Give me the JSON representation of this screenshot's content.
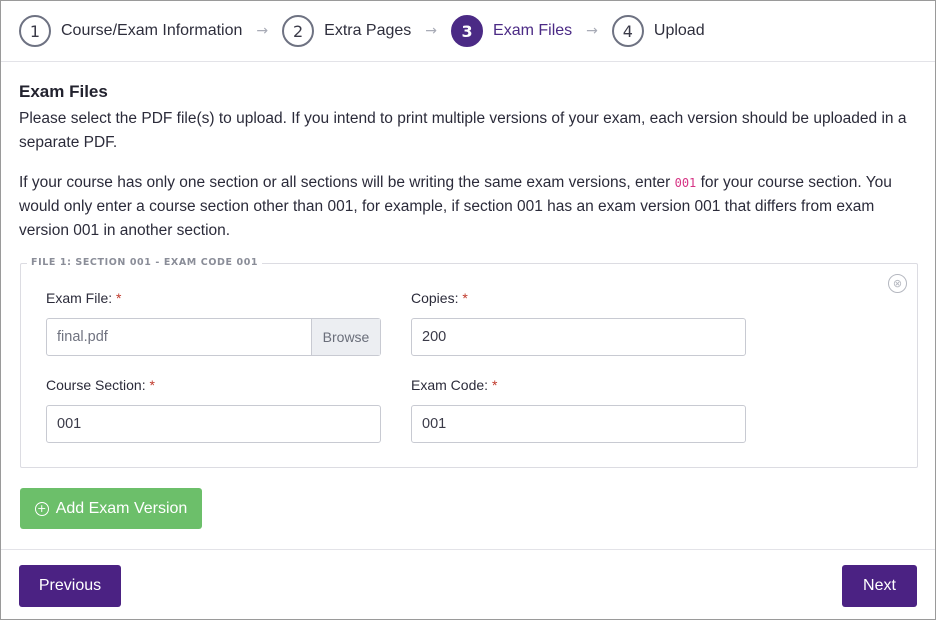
{
  "stepper": {
    "steps": [
      {
        "number": "1",
        "label": "Course/Exam Information"
      },
      {
        "number": "2",
        "label": "Extra Pages"
      },
      {
        "number": "3",
        "label": "Exam Files"
      },
      {
        "number": "4",
        "label": "Upload"
      }
    ],
    "arrow": "→",
    "active_index": 2
  },
  "main": {
    "title": "Exam Files",
    "para1": "Please select the PDF file(s) to upload. If you intend to print multiple versions of your exam, each version should be uploaded in a separate PDF.",
    "para2_before": "If your course has only one section or all sections will be writing the same exam versions, enter ",
    "para2_code": "001",
    "para2_after": " for your course section. You would only enter a course section other than 001, for example, if section 001 has an exam version 001 that differs from exam version 001 in another section."
  },
  "file_entry": {
    "legend": "FILE 1: SECTION 001 - EXAM CODE 001",
    "remove_icon": "⊗",
    "exam_file_label": "Exam File:",
    "exam_file_value": "final.pdf",
    "browse_label": "Browse",
    "copies_label": "Copies:",
    "copies_value": "200",
    "section_label": "Course Section:",
    "section_value": "001",
    "code_label": "Exam Code:",
    "code_value": "001",
    "required_mark": "*"
  },
  "actions": {
    "add_version_label": "Add Exam Version",
    "add_icon": "+",
    "previous_label": "Previous",
    "next_label": "Next"
  },
  "colors": {
    "accent": "#4b2283",
    "success": "#6cbf6a",
    "required": "#c0392b"
  }
}
